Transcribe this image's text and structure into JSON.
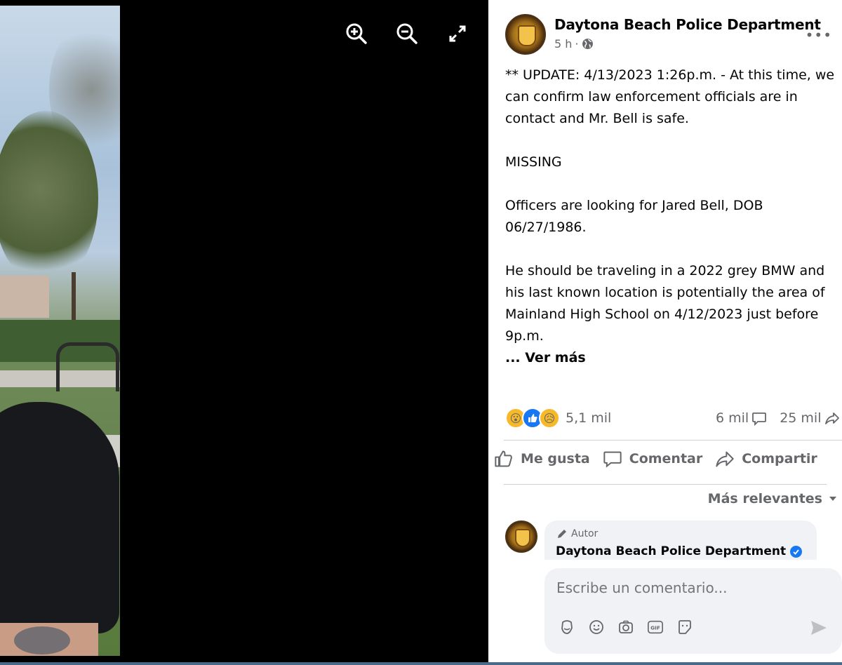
{
  "viewer": {
    "tools": [
      {
        "icon": "zoom-in-icon"
      },
      {
        "icon": "zoom-out-icon"
      },
      {
        "icon": "fullscreen-icon"
      }
    ]
  },
  "post": {
    "page_name": "Daytona Beach Police Department",
    "time": "5 h",
    "audience_icon": "globe-icon",
    "body": {
      "update": "** UPDATE: 4/13/2023 1:26p.m. - At this time, we can confirm law enforcement officials are in contact and Mr. Bell is safe.",
      "missing": "MISSING",
      "officers": "Officers are looking for Jared Bell, DOB 06/27/1986.",
      "details": "He should be traveling in a 2022 grey BMW and his last known location is potentially the area of Mainland High School on 4/12/2023 just before 9p.m.",
      "see_more": "... Ver más"
    },
    "reactions_count": "5,1 mil",
    "comments_count": "6 mil",
    "shares_count": "25 mil",
    "actions": {
      "like": "Me gusta",
      "comment": "Comentar",
      "share": "Compartir"
    },
    "sort_label": "Más relevantes"
  },
  "comment": {
    "author_tag": "Autor",
    "author_name": "Daytona Beach Police Department"
  },
  "composer": {
    "placeholder": "Escribe un comentario..."
  },
  "colors": {
    "accent": "#1877f2",
    "secondary_text": "#65676b",
    "bubble_bg": "#f0f2f5"
  }
}
